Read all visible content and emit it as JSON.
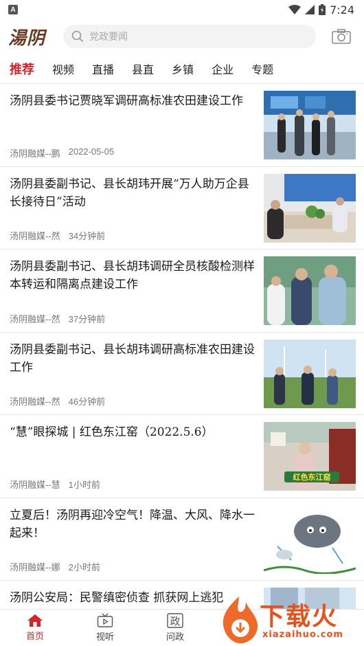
{
  "status_bar": {
    "time": "7:24",
    "app_icon": "A"
  },
  "header": {
    "logo_text": "湯阴",
    "search_placeholder": "党政要闻",
    "icons": {
      "search": "search-icon",
      "camera": "camera-icon"
    }
  },
  "tabs": [
    {
      "label": "推荐",
      "active": true
    },
    {
      "label": "视频"
    },
    {
      "label": "直播"
    },
    {
      "label": "县直"
    },
    {
      "label": "乡镇"
    },
    {
      "label": "企业"
    },
    {
      "label": "专题"
    }
  ],
  "news": [
    {
      "title": "汤阴县委书记贾晓军调研高标准农田建设工作",
      "source": "汤阴融媒--鹏",
      "time": "2022-05-05"
    },
    {
      "title": "汤阴县委副书记、县长胡玮开展“万人助万企县长接待日”活动",
      "source": "汤阴融媒--然",
      "time": "34分钟前"
    },
    {
      "title": "汤阴县委副书记、县长胡玮调研全员核酸检测样本转运和隔离点建设工作",
      "source": "汤阴融媒--然",
      "time": "37分钟前"
    },
    {
      "title": "汤阴县委副书记、县长胡玮调研高标准农田建设工作",
      "source": "汤阴融媒--然",
      "time": "46分钟前"
    },
    {
      "title": "“慧”眼探城 | 红色东江窑（2022.5.6）",
      "source": "汤阴融媒--慧",
      "time": "1小时前",
      "thumb_caption": "红色东江窑"
    },
    {
      "title": "立夏后！汤阴再迎冷空气！降温、大风、降水一起来！",
      "source": "汤阴融媒--娜",
      "time": "2小时前"
    },
    {
      "title": "汤阴公安局：民警缜密侦查 抓获网上逃犯",
      "source": "",
      "time": ""
    }
  ],
  "bottom_nav": [
    {
      "label": "首页",
      "icon": "home-icon",
      "active": true
    },
    {
      "label": "视听",
      "icon": "tv-icon"
    },
    {
      "label": "问政",
      "icon": "zheng-icon",
      "glyph": "政"
    }
  ],
  "watermark": {
    "text": "下载火",
    "url": "xiazaihuo.com"
  },
  "colors": {
    "accent": "#d4242b",
    "logo": "#6b3a23",
    "watermark": "#e8501c"
  }
}
